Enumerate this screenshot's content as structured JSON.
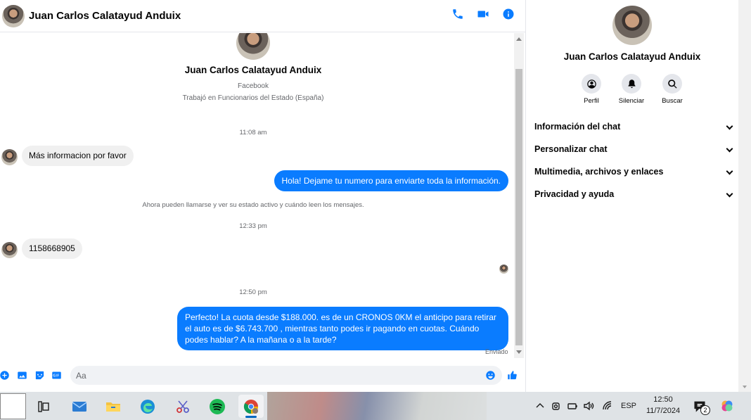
{
  "contact": {
    "name": "Juan Carlos Calatayud Anduix"
  },
  "header": {
    "actions": [
      "Llamar",
      "Videollamada",
      "Información de la conversación"
    ]
  },
  "intro": {
    "name": "Juan Carlos Calatayud Anduix",
    "network": "Facebook",
    "work": "Trabajó en Funcionarios del Estado (España)"
  },
  "messages": {
    "time1": "11:08 am",
    "m1": "Más informacion por favor",
    "m2": "Hola! Dejame tu numero  para enviarte toda la información.",
    "system": "Ahora pueden llamarse y ver su estado activo y cuándo leen los mensajes.",
    "time2": "12:33 pm",
    "m3": "1158668905",
    "time3": "12:50 pm",
    "m4": "Perfecto! La cuota desde $188.000. es de un CRONOS 0KM el anticipo para retirar el auto es de $6.743.700 , mientras tanto podes ir pagando en cuotas. Cuándo podes hablar? A la mañana o a la tarde?",
    "status": "Enviado"
  },
  "composer": {
    "placeholder": "Aa"
  },
  "info_panel": {
    "name": "Juan Carlos Calatayud Anduix",
    "actions": [
      "Perfil",
      "Silenciar",
      "Buscar"
    ],
    "sections": [
      "Información del chat",
      "Personalizar chat",
      "Multimedia, archivos y enlaces",
      "Privacidad y ayuda"
    ]
  },
  "taskbar": {
    "apps": [
      "task-view",
      "mail",
      "file-explorer",
      "edge",
      "snipping-tool",
      "spotify",
      "chrome"
    ],
    "language": "ESP",
    "time": "12:50",
    "date": "11/7/2024",
    "notifications": "2"
  },
  "colors": {
    "accent": "#0a7cff",
    "bubble_in": "#f0f0f0",
    "taskbar": "#dfe3e6"
  }
}
